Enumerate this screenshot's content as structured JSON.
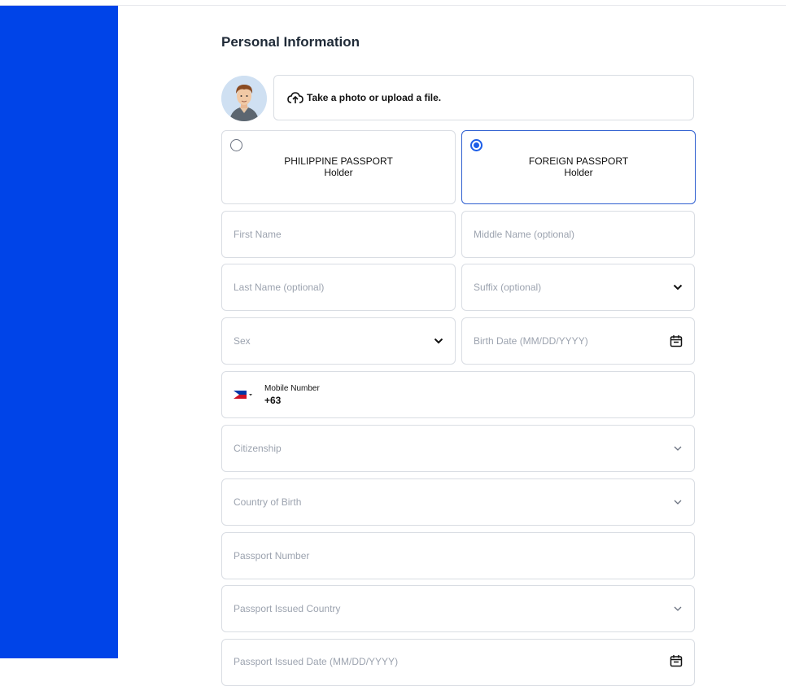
{
  "section": {
    "title": "Personal Information"
  },
  "upload": {
    "label": "Take a photo or upload a file."
  },
  "passport_options": [
    {
      "line1": "PHILIPPINE PASSPORT",
      "line2": "Holder",
      "selected": false
    },
    {
      "line1": "FOREIGN PASSPORT",
      "line2": "Holder",
      "selected": true
    }
  ],
  "fields": {
    "first_name": "First Name",
    "middle_name": "Middle Name (optional)",
    "last_name": "Last Name (optional)",
    "suffix": "Suffix (optional)",
    "sex": "Sex",
    "birth_date": "Birth Date (MM/DD/YYYY)",
    "citizenship": "Citizenship",
    "country_of_birth": "Country of Birth",
    "passport_number": "Passport Number",
    "passport_issued_country": "Passport Issued Country",
    "passport_issued_date": "Passport Issued Date (MM/DD/YYYY)"
  },
  "mobile": {
    "label": "Mobile Number",
    "value": "+63",
    "flag": "philippines-flag-icon"
  },
  "colors": {
    "sidebar": "#0044e8",
    "selected_border": "#2f5fd0",
    "radio": "#1d5ee8"
  }
}
